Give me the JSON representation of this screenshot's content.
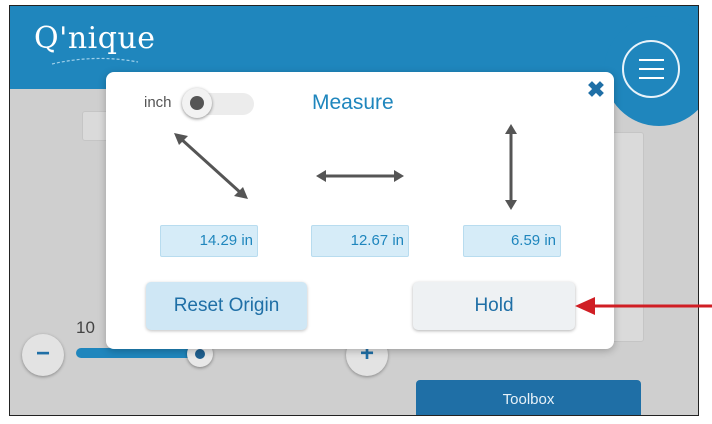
{
  "app": {
    "logo_text": "Q'nique"
  },
  "background": {
    "zoom_value": "10",
    "zoom_out_label": "−",
    "zoom_in_label": "+",
    "slider_level_fraction": 0.92,
    "toolbox_label": "Toolbox"
  },
  "dialog": {
    "title": "Measure",
    "unit_label": "inch",
    "unit_toggle_on": false,
    "close_icon": "close-icon",
    "measurements": [
      {
        "icon": "diagonal-arrow-icon",
        "value": "14.29 in"
      },
      {
        "icon": "horizontal-arrow-icon",
        "value": "12.67 in"
      },
      {
        "icon": "vertical-arrow-icon",
        "value": "6.59 in"
      }
    ],
    "reset_button": "Reset Origin",
    "hold_button": "Hold"
  },
  "colors": {
    "brand_blue": "#1f86bd",
    "dark_blue": "#1f6fa6",
    "value_box_bg": "#d6ecf8",
    "annotation_red": "#d01e24"
  }
}
